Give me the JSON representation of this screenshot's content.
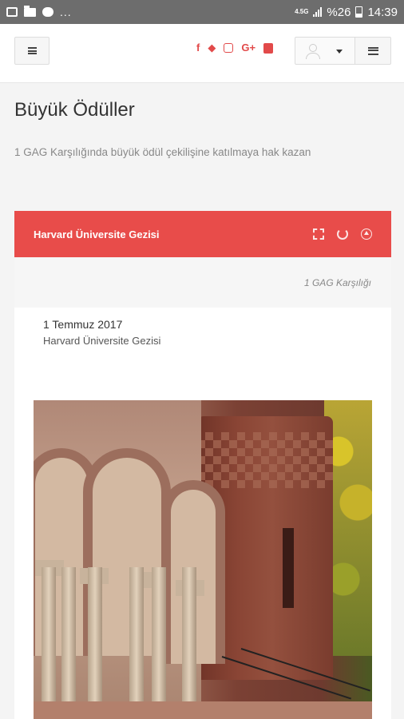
{
  "status_bar": {
    "network": "4.5G",
    "battery": "%26",
    "time": "14:39",
    "notif_more": "..."
  },
  "navbar": {
    "social": [
      "f",
      "t",
      "instagram",
      "G+",
      "youtube"
    ],
    "menu_icon": "hamburger-icon",
    "user_icon": "user-icon",
    "side_icon": "list-icon"
  },
  "page": {
    "title": "Büyük Ödüller",
    "subtitle": "1 GAG Karşılığında büyük ödül çekilişine katılmaya hak kazan"
  },
  "panel": {
    "title": "Harvard Üniversite Gezisi",
    "cost": "1 GAG Karşılığı",
    "item": {
      "date": "1 Temmuz 2017",
      "name": "Harvard Üniversite Gezisi"
    }
  },
  "colors": {
    "accent": "#e84c4a",
    "status_bar": "#6d6d6d"
  }
}
